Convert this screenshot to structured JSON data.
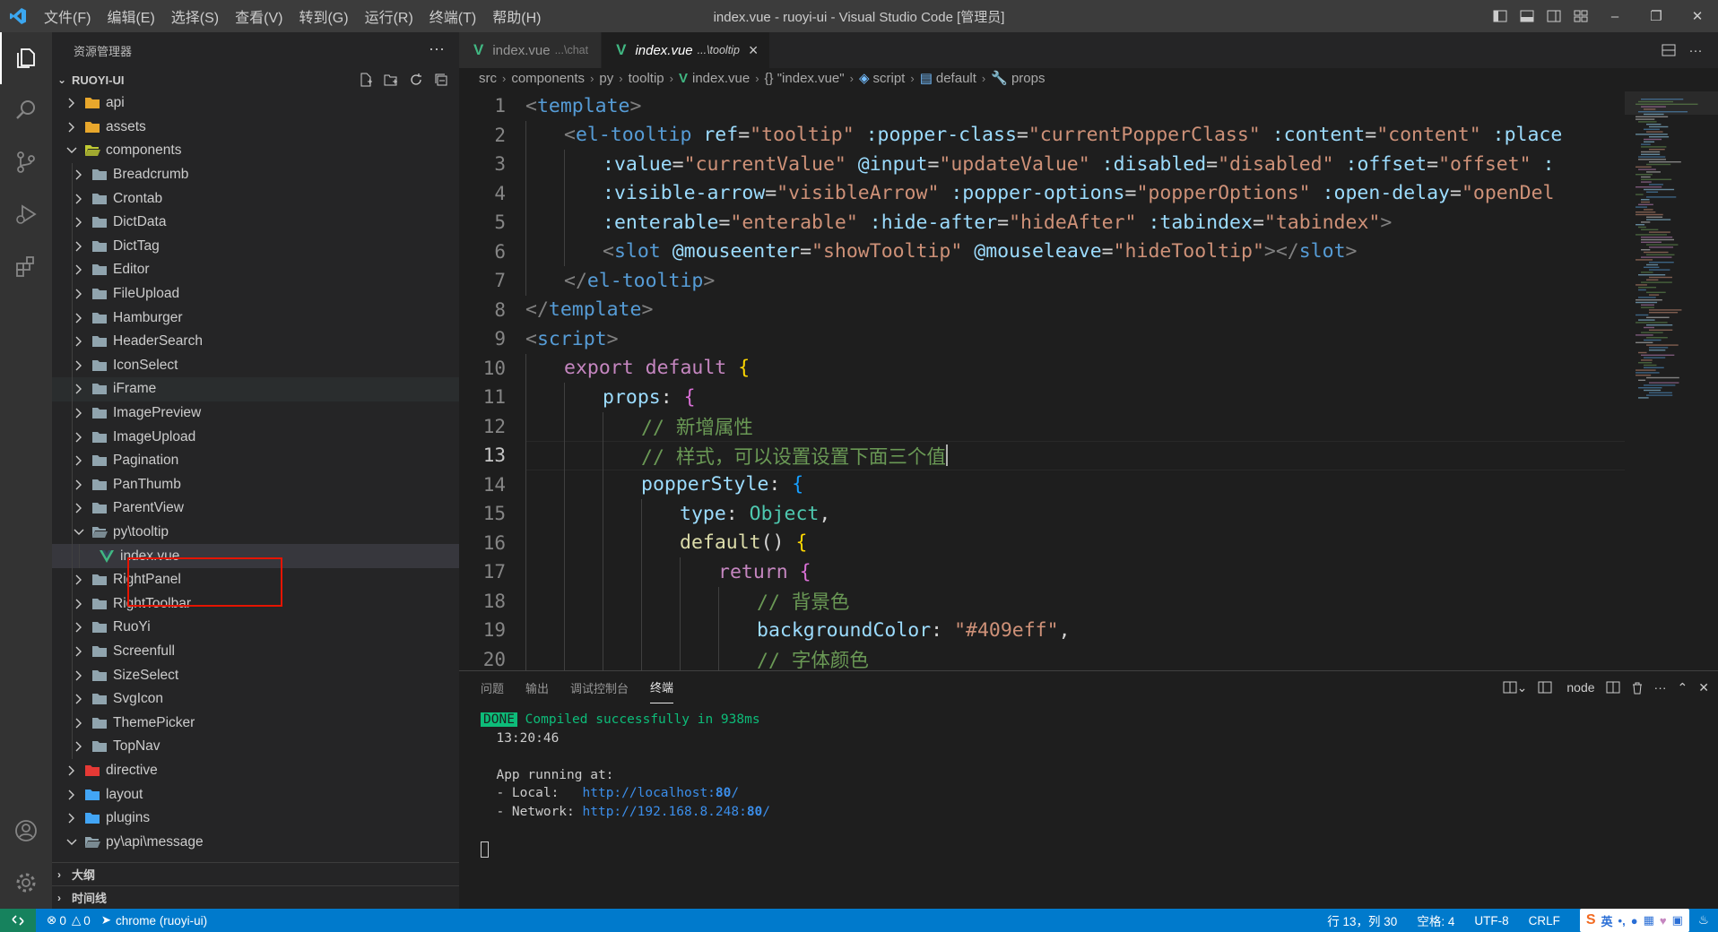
{
  "titlebar": {
    "menu": [
      "文件(F)",
      "编辑(E)",
      "选择(S)",
      "查看(V)",
      "转到(G)",
      "运行(R)",
      "终端(T)",
      "帮助(H)"
    ],
    "title": "index.vue - ruoyi-ui - Visual Studio Code [管理员]"
  },
  "sidebar": {
    "header": "资源管理器",
    "more": "···",
    "section": "RUOYI-UI",
    "tree": [
      {
        "label": "api",
        "depth": 1,
        "kind": "folder-special",
        "icon_color": "#e8a72c",
        "open": false
      },
      {
        "label": "assets",
        "depth": 1,
        "kind": "folder-special",
        "icon_color": "#e8a72c",
        "open": false
      },
      {
        "label": "components",
        "depth": 1,
        "kind": "folder-special",
        "icon_color": "#c0ca33",
        "open": true
      },
      {
        "label": "Breadcrumb",
        "depth": 2,
        "kind": "folder",
        "open": false
      },
      {
        "label": "Crontab",
        "depth": 2,
        "kind": "folder",
        "open": false
      },
      {
        "label": "DictData",
        "depth": 2,
        "kind": "folder",
        "open": false
      },
      {
        "label": "DictTag",
        "depth": 2,
        "kind": "folder",
        "open": false
      },
      {
        "label": "Editor",
        "depth": 2,
        "kind": "folder",
        "open": false
      },
      {
        "label": "FileUpload",
        "depth": 2,
        "kind": "folder",
        "open": false
      },
      {
        "label": "Hamburger",
        "depth": 2,
        "kind": "folder",
        "open": false
      },
      {
        "label": "HeaderSearch",
        "depth": 2,
        "kind": "folder",
        "open": false
      },
      {
        "label": "IconSelect",
        "depth": 2,
        "kind": "folder",
        "open": false
      },
      {
        "label": "iFrame",
        "depth": 2,
        "kind": "folder",
        "open": false,
        "state": "hover"
      },
      {
        "label": "ImagePreview",
        "depth": 2,
        "kind": "folder",
        "open": false
      },
      {
        "label": "ImageUpload",
        "depth": 2,
        "kind": "folder",
        "open": false
      },
      {
        "label": "Pagination",
        "depth": 2,
        "kind": "folder",
        "open": false
      },
      {
        "label": "PanThumb",
        "depth": 2,
        "kind": "folder",
        "open": false
      },
      {
        "label": "ParentView",
        "depth": 2,
        "kind": "folder",
        "open": false
      },
      {
        "label": "py\\tooltip",
        "depth": 2,
        "kind": "folder",
        "open": true
      },
      {
        "label": "index.vue",
        "depth": 3,
        "kind": "vue",
        "state": "selected"
      },
      {
        "label": "RightPanel",
        "depth": 2,
        "kind": "folder",
        "open": false
      },
      {
        "label": "RightToolbar",
        "depth": 2,
        "kind": "folder",
        "open": false
      },
      {
        "label": "RuoYi",
        "depth": 2,
        "kind": "folder",
        "open": false
      },
      {
        "label": "Screenfull",
        "depth": 2,
        "kind": "folder",
        "open": false
      },
      {
        "label": "SizeSelect",
        "depth": 2,
        "kind": "folder",
        "open": false
      },
      {
        "label": "SvgIcon",
        "depth": 2,
        "kind": "folder",
        "open": false
      },
      {
        "label": "ThemePicker",
        "depth": 2,
        "kind": "folder",
        "open": false
      },
      {
        "label": "TopNav",
        "depth": 2,
        "kind": "folder",
        "open": false
      },
      {
        "label": "directive",
        "depth": 1,
        "kind": "folder-special",
        "icon_color": "#e53935",
        "open": false
      },
      {
        "label": "layout",
        "depth": 1,
        "kind": "folder-special",
        "icon_color": "#42a5f5",
        "open": false
      },
      {
        "label": "plugins",
        "depth": 1,
        "kind": "folder-special",
        "icon_color": "#42a5f5",
        "open": false
      },
      {
        "label": "py\\api\\message",
        "depth": 1,
        "kind": "folder",
        "open": true
      }
    ],
    "outline": "大纲",
    "timeline": "时间线"
  },
  "editor": {
    "tabs": [
      {
        "name": "index.vue",
        "desc": "...\\chat",
        "active": false
      },
      {
        "name": "index.vue",
        "desc": "...\\tooltip",
        "active": true
      }
    ],
    "breadcrumb": [
      "src",
      "components",
      "py",
      "tooltip",
      "index.vue",
      "{} \"index.vue\"",
      "script",
      "default",
      "props"
    ],
    "current_line": 13,
    "lines": [
      {
        "n": "1",
        "indent": 0,
        "tokens": [
          [
            "<",
            "br"
          ],
          [
            "template",
            "tag"
          ],
          [
            ">",
            "br"
          ]
        ]
      },
      {
        "n": "2",
        "indent": 1,
        "tokens": [
          [
            "<",
            "br"
          ],
          [
            "el-tooltip",
            "tag"
          ],
          [
            " ",
            ""
          ],
          [
            "ref",
            "attr"
          ],
          [
            "=",
            ""
          ],
          [
            "\"tooltip\"",
            "str"
          ],
          [
            " ",
            ""
          ],
          [
            ":popper-class",
            "attr"
          ],
          [
            "=",
            ""
          ],
          [
            "\"currentPopperClass\"",
            "str"
          ],
          [
            " ",
            ""
          ],
          [
            ":content",
            "attr"
          ],
          [
            "=",
            ""
          ],
          [
            "\"content\"",
            "str"
          ],
          [
            " ",
            ""
          ],
          [
            ":place",
            "attr"
          ]
        ]
      },
      {
        "n": "3",
        "indent": 2,
        "tokens": [
          [
            ":value",
            "attr"
          ],
          [
            "=",
            ""
          ],
          [
            "\"currentValue\"",
            "str"
          ],
          [
            " ",
            ""
          ],
          [
            "@input",
            "attr"
          ],
          [
            "=",
            ""
          ],
          [
            "\"updateValue\"",
            "str"
          ],
          [
            " ",
            ""
          ],
          [
            ":disabled",
            "attr"
          ],
          [
            "=",
            ""
          ],
          [
            "\"disabled\"",
            "str"
          ],
          [
            " ",
            ""
          ],
          [
            ":offset",
            "attr"
          ],
          [
            "=",
            ""
          ],
          [
            "\"offset\"",
            "str"
          ],
          [
            " :",
            "attr"
          ]
        ]
      },
      {
        "n": "4",
        "indent": 2,
        "tokens": [
          [
            ":visible-arrow",
            "attr"
          ],
          [
            "=",
            ""
          ],
          [
            "\"visibleArrow\"",
            "str"
          ],
          [
            " ",
            ""
          ],
          [
            ":popper-options",
            "attr"
          ],
          [
            "=",
            ""
          ],
          [
            "\"popperOptions\"",
            "str"
          ],
          [
            " ",
            ""
          ],
          [
            ":open-delay",
            "attr"
          ],
          [
            "=",
            ""
          ],
          [
            "\"openDel",
            "str"
          ]
        ]
      },
      {
        "n": "5",
        "indent": 2,
        "tokens": [
          [
            ":enterable",
            "attr"
          ],
          [
            "=",
            ""
          ],
          [
            "\"enterable\"",
            "str"
          ],
          [
            " ",
            ""
          ],
          [
            ":hide-after",
            "attr"
          ],
          [
            "=",
            ""
          ],
          [
            "\"hideAfter\"",
            "str"
          ],
          [
            " ",
            ""
          ],
          [
            ":tabindex",
            "attr"
          ],
          [
            "=",
            ""
          ],
          [
            "\"tabindex\"",
            "str"
          ],
          [
            ">",
            "br"
          ]
        ]
      },
      {
        "n": "6",
        "indent": 2,
        "tokens": [
          [
            "<",
            "br"
          ],
          [
            "slot",
            "tag"
          ],
          [
            " ",
            ""
          ],
          [
            "@mouseenter",
            "attr"
          ],
          [
            "=",
            ""
          ],
          [
            "\"showTooltip\"",
            "str"
          ],
          [
            " ",
            ""
          ],
          [
            "@mouseleave",
            "attr"
          ],
          [
            "=",
            ""
          ],
          [
            "\"hideTooltip\"",
            "str"
          ],
          [
            "></",
            "br"
          ],
          [
            "slot",
            "tag"
          ],
          [
            ">",
            "br"
          ]
        ]
      },
      {
        "n": "7",
        "indent": 1,
        "tokens": [
          [
            "</",
            "br"
          ],
          [
            "el-tooltip",
            "tag"
          ],
          [
            ">",
            "br"
          ]
        ]
      },
      {
        "n": "8",
        "indent": 0,
        "tokens": [
          [
            "</",
            "br"
          ],
          [
            "template",
            "tag"
          ],
          [
            ">",
            "br"
          ]
        ]
      },
      {
        "n": "9",
        "indent": 0,
        "tokens": [
          [
            "<",
            "br"
          ],
          [
            "script",
            "tag"
          ],
          [
            ">",
            "br"
          ]
        ]
      },
      {
        "n": "10",
        "indent": 1,
        "tokens": [
          [
            "export",
            "kw"
          ],
          [
            " ",
            ""
          ],
          [
            "default",
            "kw"
          ],
          [
            " ",
            ""
          ],
          [
            "{",
            "p1"
          ]
        ]
      },
      {
        "n": "11",
        "indent": 2,
        "tokens": [
          [
            "props",
            "key"
          ],
          [
            ": ",
            ""
          ],
          [
            "{",
            "p2"
          ]
        ]
      },
      {
        "n": "12",
        "indent": 3,
        "tokens": [
          [
            "// 新增属性",
            "com"
          ]
        ]
      },
      {
        "n": "13",
        "indent": 3,
        "tokens": [
          [
            "// 样式，可以设置设置下面三个值",
            "com"
          ]
        ],
        "caret": true
      },
      {
        "n": "14",
        "indent": 3,
        "tokens": [
          [
            "popperStyle",
            "key"
          ],
          [
            ": ",
            ""
          ],
          [
            "{",
            "p3"
          ]
        ]
      },
      {
        "n": "15",
        "indent": 4,
        "tokens": [
          [
            "type",
            "key"
          ],
          [
            ": ",
            ""
          ],
          [
            "Object",
            "cls"
          ],
          [
            ",",
            ""
          ]
        ]
      },
      {
        "n": "16",
        "indent": 4,
        "tokens": [
          [
            "default",
            "fn"
          ],
          [
            "() ",
            ""
          ],
          [
            "{",
            "p1"
          ]
        ]
      },
      {
        "n": "17",
        "indent": 5,
        "tokens": [
          [
            "return",
            "kw"
          ],
          [
            " ",
            ""
          ],
          [
            "{",
            "p2"
          ]
        ]
      },
      {
        "n": "18",
        "indent": 6,
        "tokens": [
          [
            "// 背景色",
            "com"
          ]
        ]
      },
      {
        "n": "19",
        "indent": 6,
        "tokens": [
          [
            "backgroundColor",
            "key"
          ],
          [
            ": ",
            ""
          ],
          [
            "\"#409eff\"",
            "str"
          ],
          [
            ",",
            ""
          ]
        ]
      },
      {
        "n": "20",
        "indent": 6,
        "tokens": [
          [
            "// 字体颜色",
            "com"
          ]
        ]
      }
    ]
  },
  "panel": {
    "tabs": [
      "问题",
      "输出",
      "调试控制台",
      "终端"
    ],
    "active_tab": "终端",
    "terminal_profile": "node",
    "terminal": {
      "badge": "DONE",
      "compiled": "Compiled successfully in 938ms",
      "time": "13:20:46",
      "running": "App running at:",
      "local_label": "- Local:   ",
      "local_url": "http://localhost:",
      "local_port": "80",
      "network_label": "- Network: ",
      "network_url": "http://192.168.8.248:",
      "network_port": "80",
      "slash": "/"
    }
  },
  "statusbar": {
    "errors": "0",
    "warnings": "0",
    "debug_target": "chrome (ruoyi-ui)",
    "position": "行 13，列 30",
    "spaces": "空格: 4",
    "encoding": "UTF-8",
    "eol": "CRLF",
    "ime_lang": "英"
  }
}
